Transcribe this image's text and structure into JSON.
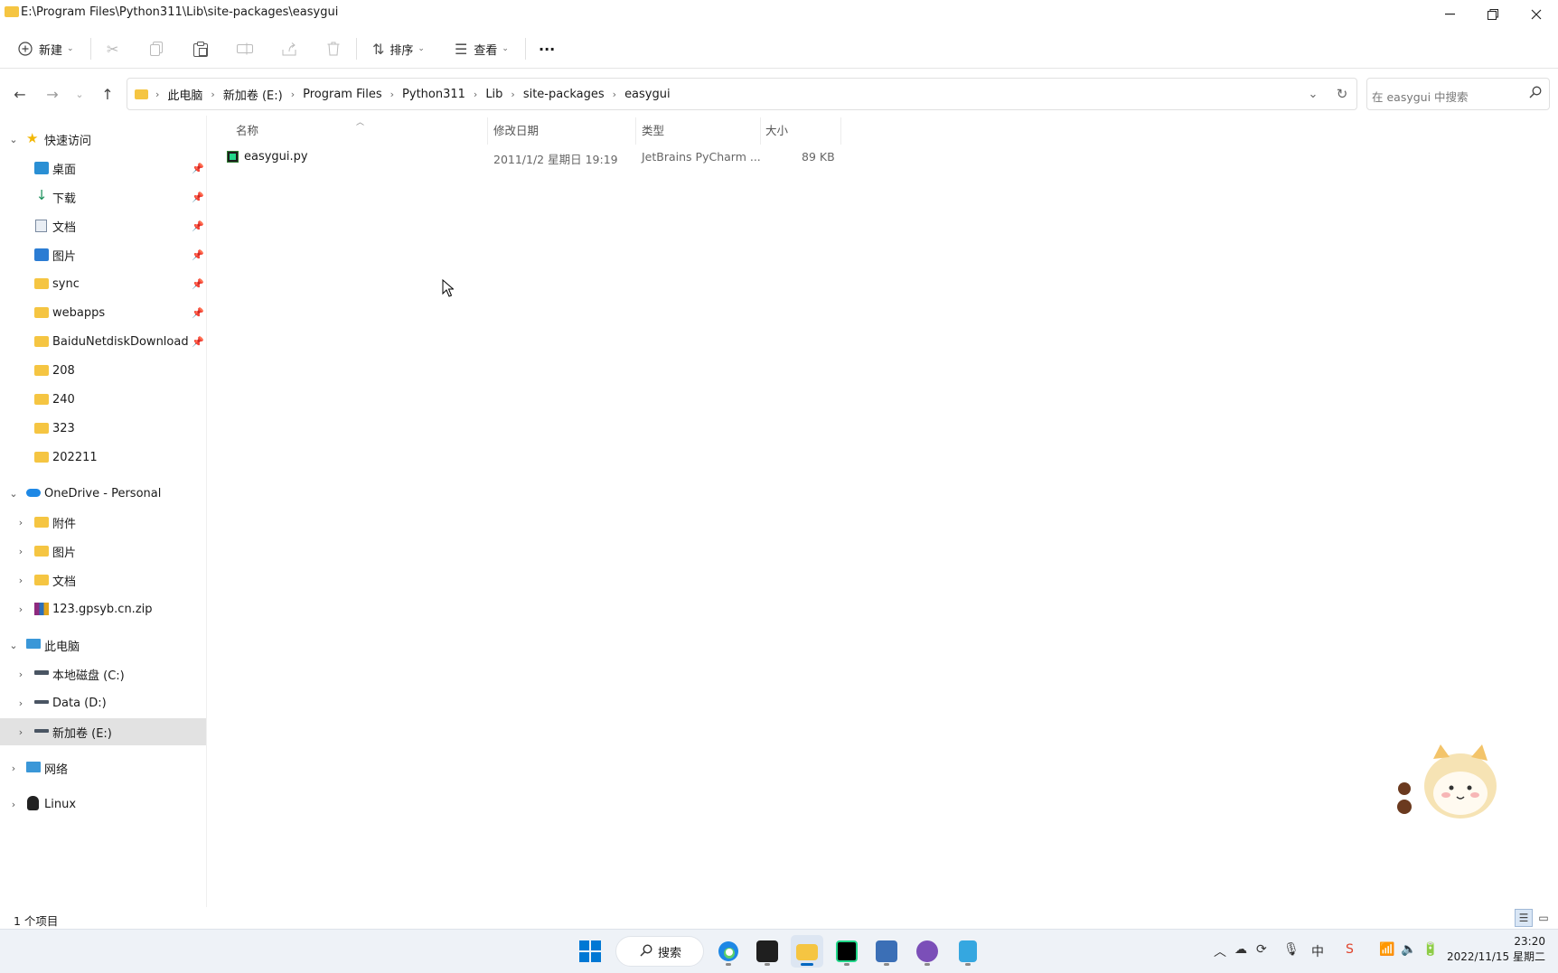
{
  "window": {
    "title": "E:\\Program Files\\Python311\\Lib\\site-packages\\easygui",
    "minimize_icon": "minimize-icon",
    "maximize_icon": "restore-icon",
    "close_icon": "close-icon"
  },
  "toolbar": {
    "new_label": "新建",
    "sort_label": "排序",
    "view_label": "查看",
    "more_label": "···"
  },
  "address": {
    "crumbs": [
      "此电脑",
      "新加卷 (E:)",
      "Program Files",
      "Python311",
      "Lib",
      "site-packages",
      "easygui"
    ],
    "search_placeholder": "在 easygui 中搜索"
  },
  "sidebar": {
    "quick_access": {
      "label": "快速访问",
      "items": [
        {
          "label": "桌面",
          "pinned": true
        },
        {
          "label": "下载",
          "pinned": true
        },
        {
          "label": "文档",
          "pinned": true
        },
        {
          "label": "图片",
          "pinned": true
        },
        {
          "label": "sync",
          "pinned": true
        },
        {
          "label": "webapps",
          "pinned": true
        },
        {
          "label": "BaiduNetdiskDownload",
          "pinned": true
        },
        {
          "label": "208",
          "pinned": false
        },
        {
          "label": "240",
          "pinned": false
        },
        {
          "label": "323",
          "pinned": false
        },
        {
          "label": "202211",
          "pinned": false
        }
      ]
    },
    "onedrive": {
      "label": "OneDrive - Personal",
      "items": [
        "附件",
        "图片",
        "文档",
        "123.gpsyb.cn.zip"
      ]
    },
    "this_pc": {
      "label": "此电脑",
      "items": [
        "本地磁盘 (C:)",
        "Data (D:)",
        "新加卷 (E:)"
      ],
      "selected": "新加卷 (E:)"
    },
    "network_label": "网络",
    "linux_label": "Linux"
  },
  "list": {
    "columns": [
      "名称",
      "修改日期",
      "类型",
      "大小"
    ],
    "rows": [
      {
        "name": "easygui.py",
        "modified": "2011/1/2 星期日 19:19",
        "type": "JetBrains PyCharm ...",
        "size": "89 KB"
      }
    ]
  },
  "status": {
    "item_count": "1 个项目"
  },
  "taskbar": {
    "search_label": "搜索",
    "time": "23:20",
    "date": "2022/11/15 星期二",
    "ime_label": "中"
  }
}
